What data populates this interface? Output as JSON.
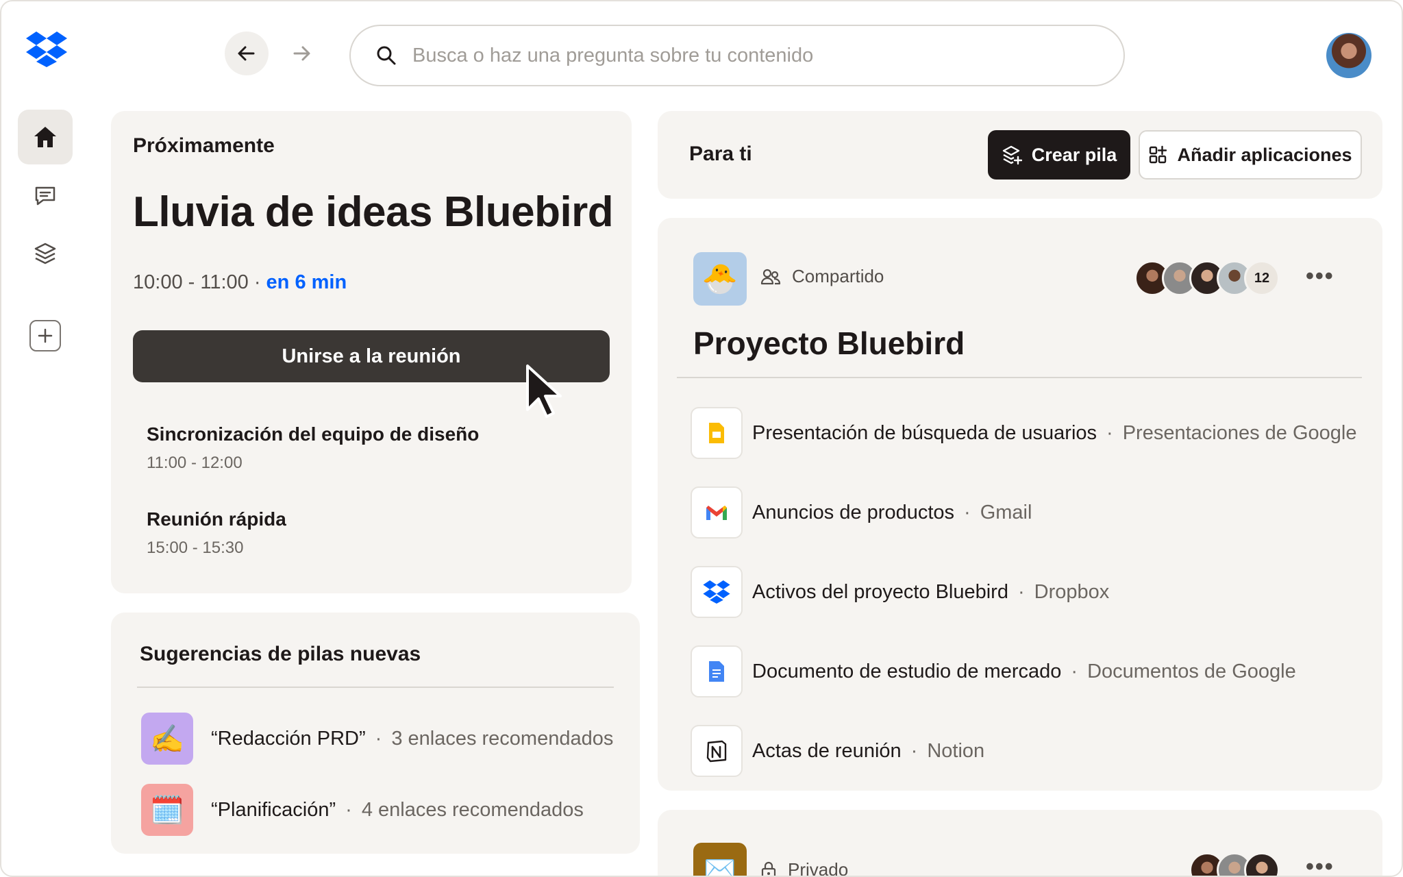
{
  "header": {
    "search_placeholder": "Busca o haz una pregunta sobre tu contenido"
  },
  "colors": {
    "accent": "#0061fe",
    "dark_button": "#1e1919",
    "join_button": "#3b3734",
    "card_bg": "#f6f4f1"
  },
  "upcoming": {
    "label": "Próximamente",
    "title": "Lluvia de ideas Bluebird",
    "time": "10:00 - 11:00 · ",
    "starts_in": "en 6 min",
    "join_label": "Unirse a la reunión",
    "events": [
      {
        "title": "Sincronización del equipo de diseño",
        "time": "11:00 - 12:00"
      },
      {
        "title": "Reunión rápida",
        "time": "15:00 - 15:30"
      }
    ]
  },
  "suggestions": {
    "title": "Sugerencias de pilas nuevas",
    "items": [
      {
        "name": "“Redacción PRD”",
        "meta": "3 enlaces recomendados",
        "icon": "✍️"
      },
      {
        "name": "“Planificación”",
        "meta": "4 enlaces recomendados",
        "icon": "🗓️"
      }
    ]
  },
  "for_you": {
    "title": "Para ti",
    "create_label": "Crear pila",
    "add_apps_label": "Añadir aplicaciones"
  },
  "project": {
    "icon": "🐣",
    "sharing": "Compartido",
    "member_count": "12",
    "more": "•••",
    "title": "Proyecto Bluebird",
    "links": [
      {
        "name": "Presentación de búsqueda de usuarios",
        "app": "Presentaciones de Google",
        "icon": "google-slides-icon"
      },
      {
        "name": "Anuncios de productos",
        "app": "Gmail",
        "icon": "gmail-icon"
      },
      {
        "name": "Activos del proyecto Bluebird",
        "app": "Dropbox",
        "icon": "dropbox-icon"
      },
      {
        "name": "Documento de estudio de mercado",
        "app": "Documentos de Google",
        "icon": "google-docs-icon"
      },
      {
        "name": "Actas de reunión",
        "app": "Notion",
        "icon": "notion-icon"
      }
    ]
  },
  "private_stack": {
    "icon": "✉️",
    "sharing": "Privado",
    "more": "•••"
  },
  "separator": "·"
}
